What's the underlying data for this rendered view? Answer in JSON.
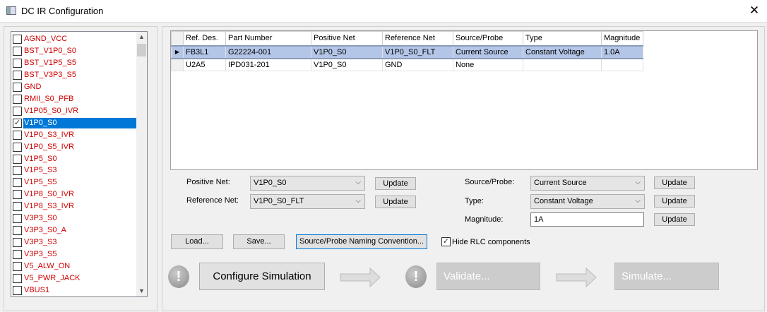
{
  "window": {
    "title": "DC IR Configuration",
    "close": "✕"
  },
  "nets": [
    {
      "label": "AGND_VCC",
      "checked": false
    },
    {
      "label": "BST_V1P0_S0",
      "checked": false
    },
    {
      "label": "BST_V1P5_S5",
      "checked": false
    },
    {
      "label": "BST_V3P3_S5",
      "checked": false
    },
    {
      "label": "GND",
      "checked": false
    },
    {
      "label": "RMII_S0_PFB",
      "checked": false
    },
    {
      "label": "V1P05_S0_IVR",
      "checked": false
    },
    {
      "label": "V1P0_S0",
      "checked": true,
      "selected": true
    },
    {
      "label": "V1P0_S3_IVR",
      "checked": false
    },
    {
      "label": "V1P0_S5_IVR",
      "checked": false
    },
    {
      "label": "V1P5_S0",
      "checked": false
    },
    {
      "label": "V1P5_S3",
      "checked": false
    },
    {
      "label": "V1P5_S5",
      "checked": false
    },
    {
      "label": "V1P8_S0_IVR",
      "checked": false
    },
    {
      "label": "V1P8_S3_IVR",
      "checked": false
    },
    {
      "label": "V3P3_S0",
      "checked": false
    },
    {
      "label": "V3P3_S0_A",
      "checked": false
    },
    {
      "label": "V3P3_S3",
      "checked": false
    },
    {
      "label": "V3P3_S5",
      "checked": false
    },
    {
      "label": "V5_ALW_ON",
      "checked": false
    },
    {
      "label": "V5_PWR_JACK",
      "checked": false
    },
    {
      "label": "VBUS1",
      "checked": false
    }
  ],
  "grid": {
    "columns": [
      "Ref. Des.",
      "Part Number",
      "Positive Net",
      "Reference Net",
      "Source/Probe",
      "Type",
      "Magnitude"
    ],
    "rows": [
      [
        "FB3L1",
        "G22224-001",
        "V1P0_S0",
        "V1P0_S0_FLT",
        "Current Source",
        "Constant Voltage",
        "1.0A"
      ],
      [
        "U2A5",
        "IPD031-201",
        "V1P0_S0",
        "GND",
        "None",
        "",
        ""
      ]
    ]
  },
  "form": {
    "positive_net_label": "Positive Net:",
    "positive_net": "V1P0_S0",
    "reference_net_label": "Reference Net:",
    "reference_net": "V1P0_S0_FLT",
    "source_probe_label": "Source/Probe:",
    "source_probe": "Current Source",
    "type_label": "Type:",
    "type": "Constant Voltage",
    "magnitude_label": "Magnitude:",
    "magnitude": "1A",
    "update": "Update"
  },
  "actions": {
    "load": "Load...",
    "save": "Save...",
    "naming": "Source/Probe Naming Convention...",
    "hide_rlc": "Hide RLC components",
    "hide_rlc_checked": true
  },
  "workflow": {
    "configure": "Configure Simulation",
    "validate": "Validate...",
    "simulate": "Simulate...",
    "alert": "!"
  }
}
